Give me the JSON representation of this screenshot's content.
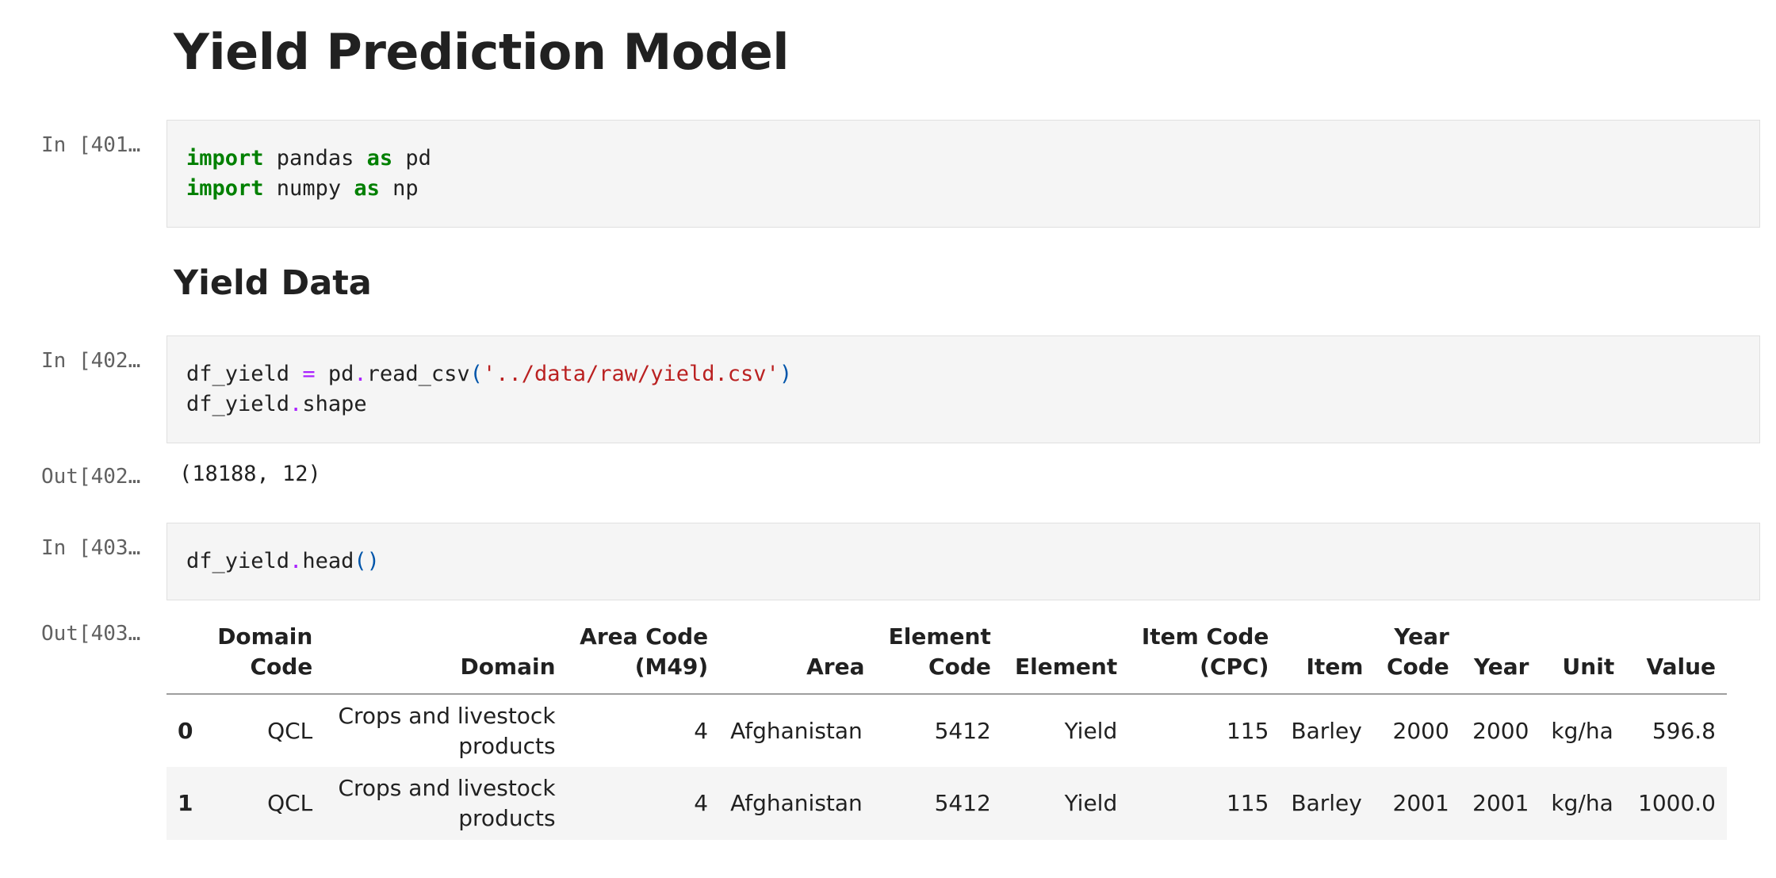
{
  "notebook": {
    "title": "Yield Prediction Model",
    "section_heading": "Yield Data"
  },
  "cells": [
    {
      "prompt": "In [401…",
      "code_lines": [
        [
          {
            "t": "import",
            "c": "kw"
          },
          {
            "t": " pandas ",
            "c": ""
          },
          {
            "t": "as",
            "c": "kw"
          },
          {
            "t": " pd",
            "c": ""
          }
        ],
        [
          {
            "t": "import",
            "c": "kw"
          },
          {
            "t": " numpy ",
            "c": ""
          },
          {
            "t": "as",
            "c": "kw"
          },
          {
            "t": " np",
            "c": ""
          }
        ]
      ]
    },
    {
      "prompt": "In [402…",
      "code_lines": [
        [
          {
            "t": "df_yield ",
            "c": ""
          },
          {
            "t": "=",
            "c": "op"
          },
          {
            "t": " pd",
            "c": ""
          },
          {
            "t": ".",
            "c": "op"
          },
          {
            "t": "read_csv",
            "c": ""
          },
          {
            "t": "(",
            "c": "paren"
          },
          {
            "t": "'../data/raw/yield.csv'",
            "c": "str"
          },
          {
            "t": ")",
            "c": "paren"
          }
        ],
        [
          {
            "t": "df_yield",
            "c": ""
          },
          {
            "t": ".",
            "c": "op"
          },
          {
            "t": "shape",
            "c": ""
          }
        ]
      ],
      "out_prompt": "Out[402…",
      "output": "(18188, 12)"
    },
    {
      "prompt": "In [403…",
      "code_lines": [
        [
          {
            "t": "df_yield",
            "c": ""
          },
          {
            "t": ".",
            "c": "op"
          },
          {
            "t": "head",
            "c": ""
          },
          {
            "t": "()",
            "c": "paren"
          }
        ]
      ],
      "out_prompt": "Out[403…"
    }
  ],
  "dataframe": {
    "columns": [
      "",
      "Domain Code",
      "Domain",
      "Area Code (M49)",
      "Area",
      "Element Code",
      "Element",
      "Item Code (CPC)",
      "Item",
      "Year Code",
      "Year",
      "Unit",
      "Value"
    ],
    "column_html": [
      "",
      "Domain<br>Code",
      "Domain",
      "Area Code<br>(M49)",
      "Area",
      "Element<br>Code",
      "Element",
      "Item Code<br>(CPC)",
      "Item",
      "Year<br>Code",
      "Year",
      "Unit",
      "Value"
    ],
    "rows": [
      [
        "0",
        "QCL",
        "Crops and livestock products",
        "4",
        "Afghanistan",
        "5412",
        "Yield",
        "115",
        "Barley",
        "2000",
        "2000",
        "kg/ha",
        "596.8"
      ],
      [
        "1",
        "QCL",
        "Crops and livestock products",
        "4",
        "Afghanistan",
        "5412",
        "Yield",
        "115",
        "Barley",
        "2001",
        "2001",
        "kg/ha",
        "1000.0"
      ]
    ]
  }
}
